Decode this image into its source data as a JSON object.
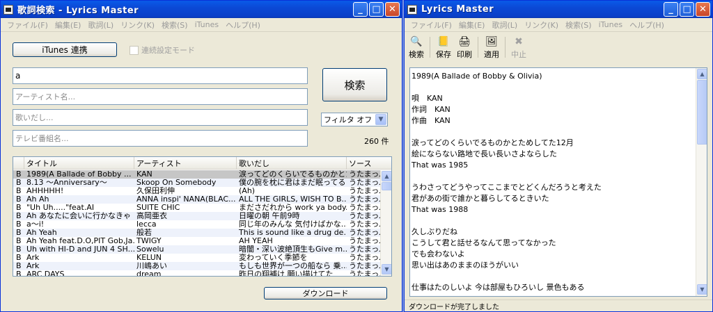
{
  "left_window": {
    "title": "歌詞検索 - Lyrics Master",
    "menu": [
      "ファイル(F)",
      "編集(E)",
      "歌詞(L)",
      "リンク(K)",
      "検索(S)",
      "iTunes",
      "ヘルプ(H)"
    ],
    "itunes_button": "iTunes 連携",
    "continuous_label": "連続設定モード",
    "search": {
      "value": "a",
      "artist_placeholder": "アーティスト名...",
      "lyrics_placeholder": "歌いだし...",
      "tv_placeholder": "テレビ番組名..."
    },
    "search_button": "検索",
    "filter_value": "フィルタ オフ",
    "result_count": "260 件",
    "download_button": "ダウンロード",
    "table": {
      "columns": [
        "タイトル",
        "アーティスト",
        "歌いだし",
        "ソース"
      ],
      "rows": [
        {
          "mark": "B",
          "title": "1989(A Ballade of Bobby ...",
          "artist": "KAN",
          "lyrics": "涙ってどのくらいでるものかとた...",
          "source": "うたまっぷ"
        },
        {
          "mark": "B",
          "title": "8.13 ～Anniversary～",
          "artist": "Skoop On Somebody",
          "lyrics": "僕の腕を枕に君はまだ眠ってる",
          "source": "うたまっぷ"
        },
        {
          "mark": "B",
          "title": "AHHHHH!",
          "artist": "久保田利伸",
          "lyrics": "(Ah)",
          "source": "うたまっぷ"
        },
        {
          "mark": "B",
          "title": "Ah Ah",
          "artist": "ANNA inspi' NANA(BLAC...",
          "lyrics": "ALL THE GIRLS, WISH TO B...",
          "source": "うたまっぷ"
        },
        {
          "mark": "B",
          "title": "\"Uh Uh.....\"feat.AI",
          "artist": "SUITE CHIC",
          "lyrics": "まださだれから work ya body...",
          "source": "うたまっぷ"
        },
        {
          "mark": "B",
          "title": "Ah あなたに会いに行かなきゃ",
          "artist": "高岡亜衣",
          "lyrics": "日曜の朝 午前9時",
          "source": "うたまっぷ"
        },
        {
          "mark": "B",
          "title": "a～i!",
          "artist": "lecca",
          "lyrics": "同じ年のみんな 気付けばかな...",
          "source": "うたまっぷ"
        },
        {
          "mark": "B",
          "title": "Ah Yeah",
          "artist": "般若",
          "lyrics": "This is sound like a drug de...",
          "source": "うたまっぷ"
        },
        {
          "mark": "B",
          "title": "Ah Yeah feat.D.O,PIT Gob,Ja...",
          "artist": "TWIGY",
          "lyrics": "AH YEAH",
          "source": "うたまっぷ"
        },
        {
          "mark": "B",
          "title": "Uh with HI-D and JUN 4 SH...",
          "artist": "Sowelu",
          "lyrics": "暗闇・深い波絶頂生もGive m...",
          "source": "うたまっぷ"
        },
        {
          "mark": "B",
          "title": "Ark",
          "artist": "KELUN",
          "lyrics": "変わっていく季節を",
          "source": "うたまっぷ"
        },
        {
          "mark": "B",
          "title": "Ark",
          "artist": "川嶋あい",
          "lyrics": "もしも世界が一つの船なら 乗...",
          "source": "うたまっぷ"
        },
        {
          "mark": "B",
          "title": "ARC DAYS",
          "artist": "dream",
          "lyrics": "昨日の翔補け 願い描けてた",
          "source": "うたまっぷ"
        }
      ]
    }
  },
  "right_window": {
    "title": "Lyrics Master",
    "menu": [
      "ファイル(F)",
      "編集(E)",
      "歌詞(L)",
      "リンク(K)",
      "検索(S)",
      "iTunes",
      "ヘルプ(H)"
    ],
    "toolbar": {
      "search": "検索",
      "save": "保存",
      "print": "印刷",
      "apply": "適用",
      "stop": "中止"
    },
    "lyrics_lines": [
      "1989(A Ballade of Bobby & Olivia)",
      "",
      "唄　KAN",
      "作詞　KAN",
      "作曲　KAN",
      "",
      "涙ってどのくらいでるものかとためしてた12月",
      "絵にならない路地で長い長いさよならした",
      "That was 1985",
      "",
      "うわさってどうやってここまでとどくんだろうと考えた",
      "君があの街で誰かと暮らしてるときいた",
      "That was 1988",
      "",
      "久しぶりだね",
      "こうして君と話せるなんて思ってなかった",
      "でも会わないよ",
      "思い出はあのままのほうがいい",
      "",
      "仕事はたのしいよ 今は部屋もひろいし 景色もある"
    ],
    "status": "ダウンロードが完了しました"
  }
}
